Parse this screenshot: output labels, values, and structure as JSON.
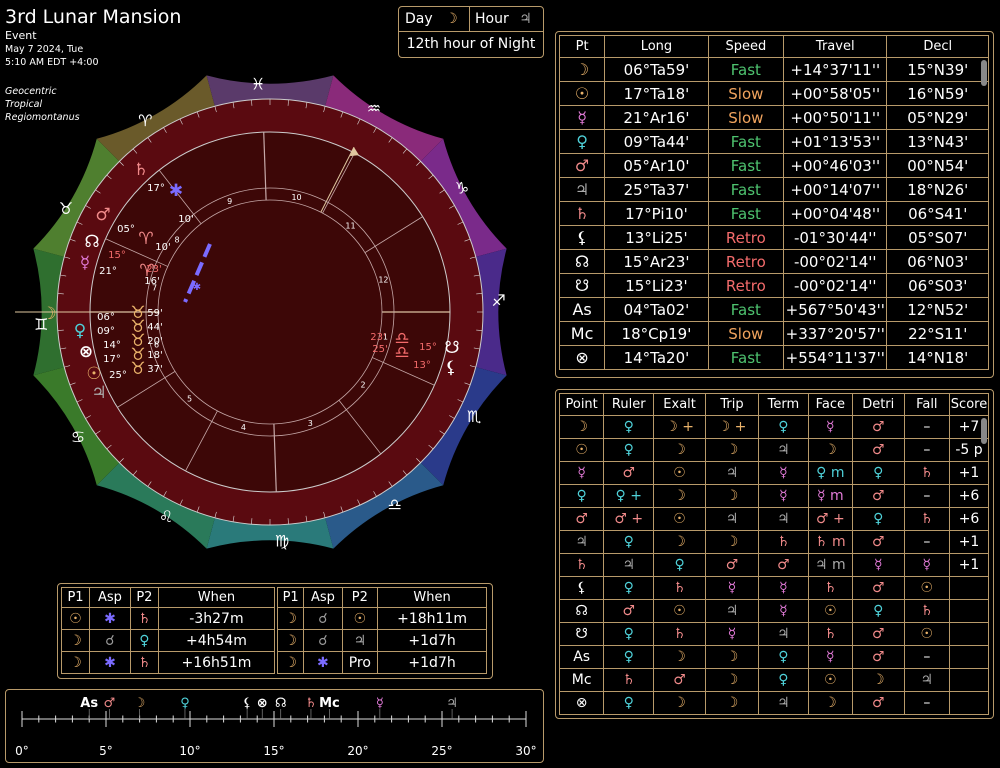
{
  "header": {
    "title": "3rd Lunar Mansion",
    "subtitle": "Event",
    "date": "May 7 2024, Tue",
    "time": "5:10 AM EDT +4:00",
    "settings": [
      "Geocentric",
      "Tropical",
      "Regiomontanus"
    ]
  },
  "dayhour": {
    "day_label": "Day",
    "day_glyph": "☽",
    "hour_label": "Hour",
    "hour_glyph": "♃",
    "hour_text": "12th hour of Night"
  },
  "colors": {
    "fast": "#4ec36f",
    "slow": "#f1a45e",
    "retro": "#f36b6b",
    "border": "#b89a6a",
    "wheel_bg": "#3d0707"
  },
  "positions": {
    "headers": [
      "Pt",
      "Long",
      "Speed",
      "Travel",
      "Decl"
    ],
    "rows": [
      {
        "glyph": "☽",
        "color": "#e9b26a",
        "long": "06°Ta59'",
        "speed": "Fast",
        "cls": "fast",
        "travel": "+14°37'11''",
        "decl": "15°N39'"
      },
      {
        "glyph": "☉",
        "color": "#e9b26a",
        "long": "17°Ta18'",
        "speed": "Slow",
        "cls": "slow",
        "travel": "+00°58'05''",
        "decl": "16°N59'"
      },
      {
        "glyph": "☿",
        "color": "#e37bd9",
        "long": "21°Ar16'",
        "speed": "Slow",
        "cls": "slow",
        "travel": "+00°50'11''",
        "decl": "05°N29'"
      },
      {
        "glyph": "♀",
        "color": "#4fd1d9",
        "long": "09°Ta44'",
        "speed": "Fast",
        "cls": "fast",
        "travel": "+01°13'53''",
        "decl": "13°N43'"
      },
      {
        "glyph": "♂",
        "color": "#f08a8a",
        "long": "05°Ar10'",
        "speed": "Fast",
        "cls": "fast",
        "travel": "+00°46'03''",
        "decl": "00°N54'"
      },
      {
        "glyph": "♃",
        "color": "#aaaaaa",
        "long": "25°Ta37'",
        "speed": "Fast",
        "cls": "fast",
        "travel": "+00°14'07''",
        "decl": "18°N26'"
      },
      {
        "glyph": "♄",
        "color": "#f08a8a",
        "long": "17°Pi10'",
        "speed": "Fast",
        "cls": "fast",
        "travel": "+00°04'48''",
        "decl": "06°S41'"
      },
      {
        "glyph": "⚸",
        "color": "#ffffff",
        "long": "13°Li25'",
        "speed": "Retro",
        "cls": "retro",
        "travel": "-01°30'44''",
        "decl": "05°S07'"
      },
      {
        "glyph": "☊",
        "color": "#ffffff",
        "long": "15°Ar23'",
        "speed": "Retro",
        "cls": "retro",
        "travel": "-00°02'14''",
        "decl": "06°N03'"
      },
      {
        "glyph": "☋",
        "color": "#ffffff",
        "long": "15°Li23'",
        "speed": "Retro",
        "cls": "retro",
        "travel": "-00°02'14''",
        "decl": "06°S03'"
      },
      {
        "glyph": "As",
        "color": "#ffffff",
        "long": "04°Ta02'",
        "speed": "Fast",
        "cls": "fast",
        "travel": "+567°50'43''",
        "decl": "12°N52'"
      },
      {
        "glyph": "Mc",
        "color": "#ffffff",
        "long": "18°Cp19'",
        "speed": "Slow",
        "cls": "slow",
        "travel": "+337°20'57''",
        "decl": "22°S11'"
      },
      {
        "glyph": "⊗",
        "color": "#ffffff",
        "long": "14°Ta20'",
        "speed": "Fast",
        "cls": "fast",
        "travel": "+554°11'37''",
        "decl": "14°N18'"
      }
    ]
  },
  "dignities": {
    "headers": [
      "Point",
      "Ruler",
      "Exalt",
      "Trip",
      "Term",
      "Face",
      "Detri",
      "Fall",
      "Score"
    ],
    "rows": [
      {
        "pt": "☽",
        "ptc": "#e9b26a",
        "cells": [
          [
            "♀",
            "#4fd1d9"
          ],
          [
            "☽ +",
            "#e9b26a"
          ],
          [
            "☽ +",
            "#e9b26a"
          ],
          [
            "♀",
            "#4fd1d9"
          ],
          [
            "☿",
            "#e37bd9"
          ],
          [
            "♂",
            "#f08a8a"
          ],
          [
            "–",
            "#ffffff"
          ]
        ],
        "score": "+7"
      },
      {
        "pt": "☉",
        "ptc": "#e9b26a",
        "cells": [
          [
            "♀",
            "#4fd1d9"
          ],
          [
            "☽",
            "#e9b26a"
          ],
          [
            "☽",
            "#e9b26a"
          ],
          [
            "♃",
            "#aaaaaa"
          ],
          [
            "☽",
            "#e9b26a"
          ],
          [
            "♂",
            "#f08a8a"
          ],
          [
            "–",
            "#ffffff"
          ]
        ],
        "score": "-5 p"
      },
      {
        "pt": "☿",
        "ptc": "#e37bd9",
        "cells": [
          [
            "♂",
            "#f08a8a"
          ],
          [
            "☉",
            "#e9b26a"
          ],
          [
            "♃",
            "#aaaaaa"
          ],
          [
            "☿",
            "#e37bd9"
          ],
          [
            "♀ m",
            "#4fd1d9"
          ],
          [
            "♀",
            "#4fd1d9"
          ],
          [
            "♄",
            "#f08a8a"
          ]
        ],
        "score": "+1"
      },
      {
        "pt": "♀",
        "ptc": "#4fd1d9",
        "cells": [
          [
            "♀ +",
            "#4fd1d9"
          ],
          [
            "☽",
            "#e9b26a"
          ],
          [
            "☽",
            "#e9b26a"
          ],
          [
            "☿",
            "#e37bd9"
          ],
          [
            "☿ m",
            "#e37bd9"
          ],
          [
            "♂",
            "#f08a8a"
          ],
          [
            "–",
            "#ffffff"
          ]
        ],
        "score": "+6"
      },
      {
        "pt": "♂",
        "ptc": "#f08a8a",
        "cells": [
          [
            "♂ +",
            "#f08a8a"
          ],
          [
            "☉",
            "#e9b26a"
          ],
          [
            "♃",
            "#aaaaaa"
          ],
          [
            "♃",
            "#aaaaaa"
          ],
          [
            "♂ +",
            "#f08a8a"
          ],
          [
            "♀",
            "#4fd1d9"
          ],
          [
            "♄",
            "#f08a8a"
          ]
        ],
        "score": "+6"
      },
      {
        "pt": "♃",
        "ptc": "#aaaaaa",
        "cells": [
          [
            "♀",
            "#4fd1d9"
          ],
          [
            "☽",
            "#e9b26a"
          ],
          [
            "☽",
            "#e9b26a"
          ],
          [
            "♄",
            "#f08a8a"
          ],
          [
            "♄ m",
            "#f08a8a"
          ],
          [
            "♂",
            "#f08a8a"
          ],
          [
            "–",
            "#ffffff"
          ]
        ],
        "score": "+1"
      },
      {
        "pt": "♄",
        "ptc": "#f08a8a",
        "cells": [
          [
            "♃",
            "#aaaaaa"
          ],
          [
            "♀",
            "#4fd1d9"
          ],
          [
            "♂",
            "#f08a8a"
          ],
          [
            "♂",
            "#f08a8a"
          ],
          [
            "♃ m",
            "#aaaaaa"
          ],
          [
            "☿",
            "#e37bd9"
          ],
          [
            "☿",
            "#e37bd9"
          ]
        ],
        "score": "+1"
      },
      {
        "pt": "⚸",
        "ptc": "#ffffff",
        "cells": [
          [
            "♀",
            "#4fd1d9"
          ],
          [
            "♄",
            "#f08a8a"
          ],
          [
            "☿",
            "#e37bd9"
          ],
          [
            "☿",
            "#e37bd9"
          ],
          [
            "♄",
            "#f08a8a"
          ],
          [
            "♂",
            "#f08a8a"
          ],
          [
            "☉",
            "#e9b26a"
          ]
        ],
        "score": ""
      },
      {
        "pt": "☊",
        "ptc": "#ffffff",
        "cells": [
          [
            "♂",
            "#f08a8a"
          ],
          [
            "☉",
            "#e9b26a"
          ],
          [
            "♃",
            "#aaaaaa"
          ],
          [
            "☿",
            "#e37bd9"
          ],
          [
            "☉",
            "#e9b26a"
          ],
          [
            "♀",
            "#4fd1d9"
          ],
          [
            "♄",
            "#f08a8a"
          ]
        ],
        "score": ""
      },
      {
        "pt": "☋",
        "ptc": "#ffffff",
        "cells": [
          [
            "♀",
            "#4fd1d9"
          ],
          [
            "♄",
            "#f08a8a"
          ],
          [
            "☿",
            "#e37bd9"
          ],
          [
            "♃",
            "#aaaaaa"
          ],
          [
            "♄",
            "#f08a8a"
          ],
          [
            "♂",
            "#f08a8a"
          ],
          [
            "☉",
            "#e9b26a"
          ]
        ],
        "score": ""
      },
      {
        "pt": "As",
        "ptc": "#ffffff",
        "cells": [
          [
            "♀",
            "#4fd1d9"
          ],
          [
            "☽",
            "#e9b26a"
          ],
          [
            "☽",
            "#e9b26a"
          ],
          [
            "♀",
            "#4fd1d9"
          ],
          [
            "☿",
            "#e37bd9"
          ],
          [
            "♂",
            "#f08a8a"
          ],
          [
            "–",
            "#ffffff"
          ]
        ],
        "score": ""
      },
      {
        "pt": "Mc",
        "ptc": "#ffffff",
        "cells": [
          [
            "♄",
            "#f08a8a"
          ],
          [
            "♂",
            "#f08a8a"
          ],
          [
            "☽",
            "#e9b26a"
          ],
          [
            "♀",
            "#4fd1d9"
          ],
          [
            "☉",
            "#e9b26a"
          ],
          [
            "☽",
            "#e9b26a"
          ],
          [
            "♃",
            "#aaaaaa"
          ]
        ],
        "score": ""
      },
      {
        "pt": "⊗",
        "ptc": "#ffffff",
        "cells": [
          [
            "♀",
            "#4fd1d9"
          ],
          [
            "☽",
            "#e9b26a"
          ],
          [
            "☽",
            "#e9b26a"
          ],
          [
            "♃",
            "#aaaaaa"
          ],
          [
            "☽",
            "#e9b26a"
          ],
          [
            "♂",
            "#f08a8a"
          ],
          [
            "–",
            "#ffffff"
          ]
        ],
        "score": ""
      }
    ]
  },
  "aspects": {
    "headers": [
      "P1",
      "Asp",
      "P2",
      "When"
    ],
    "left": [
      {
        "p1": "☉",
        "p1c": "#e9b26a",
        "asp": "✱",
        "aspc": "#7b6bff",
        "p2": "♄",
        "p2c": "#f08a8a",
        "when": "-3h27m"
      },
      {
        "p1": "☽",
        "p1c": "#e9b26a",
        "asp": "☌",
        "aspc": "#999999",
        "p2": "♀",
        "p2c": "#4fd1d9",
        "when": "+4h54m"
      },
      {
        "p1": "☽",
        "p1c": "#e9b26a",
        "asp": "✱",
        "aspc": "#7b6bff",
        "p2": "♄",
        "p2c": "#f08a8a",
        "when": "+16h51m"
      }
    ],
    "right": [
      {
        "p1": "☽",
        "p1c": "#e9b26a",
        "asp": "☌",
        "aspc": "#999999",
        "p2": "☉",
        "p2c": "#e9b26a",
        "when": "+18h11m"
      },
      {
        "p1": "☽",
        "p1c": "#e9b26a",
        "asp": "☌",
        "aspc": "#999999",
        "p2": "♃",
        "p2c": "#aaaaaa",
        "when": "+1d7h"
      },
      {
        "p1": "☽",
        "p1c": "#e9b26a",
        "asp": "✱",
        "aspc": "#7b6bff",
        "p2": "Pro",
        "p2c": "#ffffff",
        "when": "+1d7h"
      }
    ]
  },
  "degree_ruler": {
    "ticks": [
      "0°",
      "5°",
      "10°",
      "15°",
      "20°",
      "25°",
      "30°"
    ],
    "markers": [
      {
        "g": "As",
        "c": "#ffffff",
        "deg": 4.0
      },
      {
        "g": "♂",
        "c": "#f08a8a",
        "deg": 5.2
      },
      {
        "g": "☽",
        "c": "#e9b26a",
        "deg": 7.0
      },
      {
        "g": "♀",
        "c": "#4fd1d9",
        "deg": 9.7
      },
      {
        "g": "⚸",
        "c": "#ffffff",
        "deg": 13.4
      },
      {
        "g": "⊗",
        "c": "#ffffff",
        "deg": 14.3
      },
      {
        "g": "☊",
        "c": "#ffffff",
        "deg": 15.4
      },
      {
        "g": "♄",
        "c": "#f08a8a",
        "deg": 17.2
      },
      {
        "g": "Mc",
        "c": "#ffffff",
        "deg": 18.3
      },
      {
        "g": "☿",
        "c": "#e37bd9",
        "deg": 21.3
      },
      {
        "g": "♃",
        "c": "#aaaaaa",
        "deg": 25.6
      }
    ]
  },
  "wheel": {
    "zodiac": [
      {
        "g": "♉",
        "deg": 15
      },
      {
        "g": "♈",
        "deg": 45
      },
      {
        "g": "♓",
        "deg": 75
      },
      {
        "g": "♒",
        "deg": 105
      },
      {
        "g": "♑",
        "deg": 135
      },
      {
        "g": "♐",
        "deg": 165
      },
      {
        "g": "♏",
        "deg": 195
      },
      {
        "g": "♎",
        "deg": 225
      },
      {
        "g": "♍",
        "deg": 255
      },
      {
        "g": "♌",
        "deg": 285
      },
      {
        "g": "♋",
        "deg": 315
      },
      {
        "g": "♊",
        "deg": 345
      }
    ],
    "houses": [
      "1",
      "2",
      "3",
      "4",
      "5",
      "6",
      "7",
      "8",
      "9",
      "10",
      "11",
      "12"
    ],
    "planet_labels": [
      {
        "text": "06°",
        "c": "#ffffff"
      },
      {
        "text": "09°",
        "c": "#ffffff"
      },
      {
        "text": "14°",
        "c": "#ffffff"
      },
      {
        "text": "17°",
        "c": "#ffffff"
      },
      {
        "text": "25°",
        "c": "#ffffff"
      },
      {
        "text": "59'",
        "c": "#ffffff"
      },
      {
        "text": "44'",
        "c": "#ffffff"
      },
      {
        "text": "20'",
        "c": "#ffffff"
      },
      {
        "text": "18'",
        "c": "#ffffff"
      },
      {
        "text": "37'",
        "c": "#ffffff"
      },
      {
        "text": "05°",
        "c": "#ffffff"
      },
      {
        "text": "10'",
        "c": "#ffffff"
      },
      {
        "text": "15°",
        "c": "#f36b6b"
      },
      {
        "text": "21°",
        "c": "#ffffff"
      },
      {
        "text": "23'",
        "c": "#f36b6b"
      },
      {
        "text": "16'",
        "c": "#ffffff"
      },
      {
        "text": "17°",
        "c": "#ffffff"
      },
      {
        "text": "10'",
        "c": "#ffffff"
      },
      {
        "text": "23'",
        "c": "#f36b6b"
      },
      {
        "text": "25'",
        "c": "#f36b6b"
      },
      {
        "text": "15°",
        "c": "#f36b6b"
      },
      {
        "text": "13°",
        "c": "#f36b6b"
      }
    ]
  }
}
